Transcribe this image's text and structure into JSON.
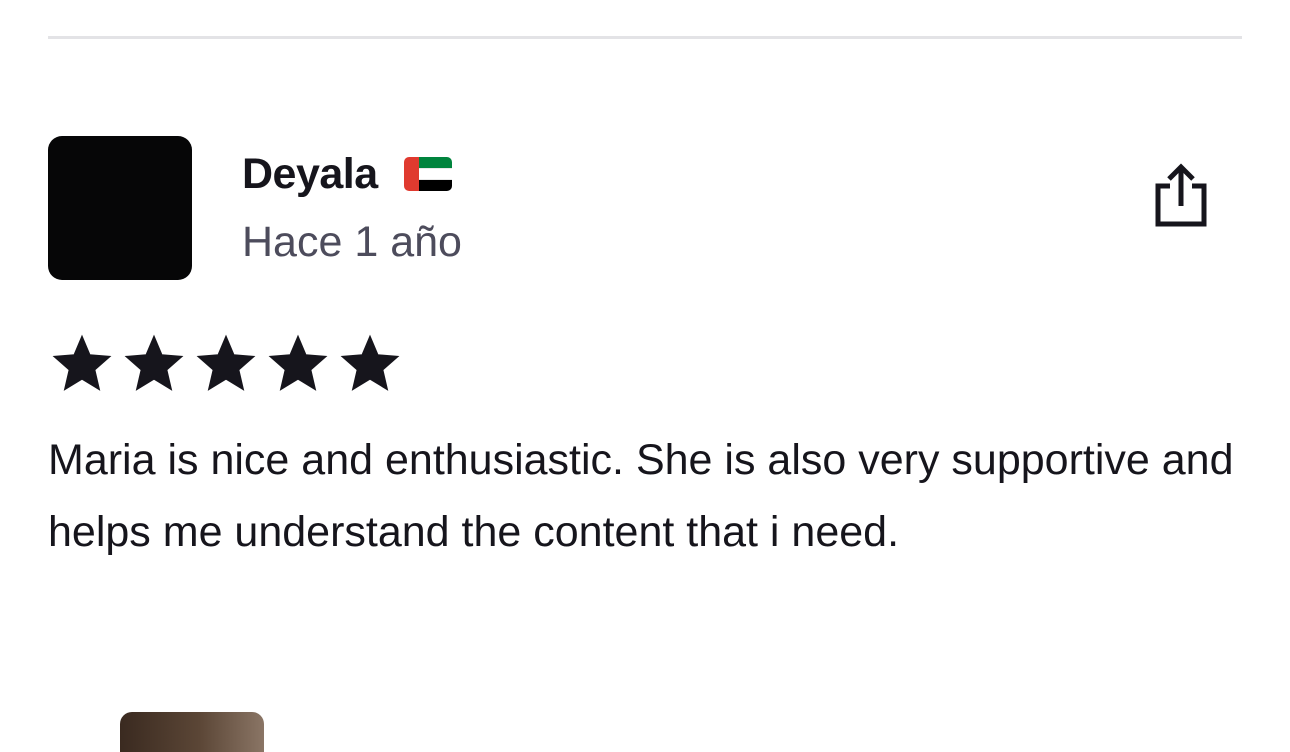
{
  "review": {
    "reviewer_name": "Deyala",
    "reviewer_country_flag": "uae-flag-icon",
    "timestamp": "Hace 1 año",
    "rating": 5,
    "rating_max": 5,
    "text": "Maria is nice and enthusiastic. She is also very supportive and helps me understand the content that i need."
  },
  "icons": {
    "share": "share-icon",
    "star": "star-icon"
  },
  "colors": {
    "text_primary": "#16151c",
    "text_secondary": "#4d4c5c",
    "divider": "#e3e3e6",
    "avatar_bg": "#060607",
    "flag_red": "#e03a2f",
    "flag_green": "#00843d"
  }
}
